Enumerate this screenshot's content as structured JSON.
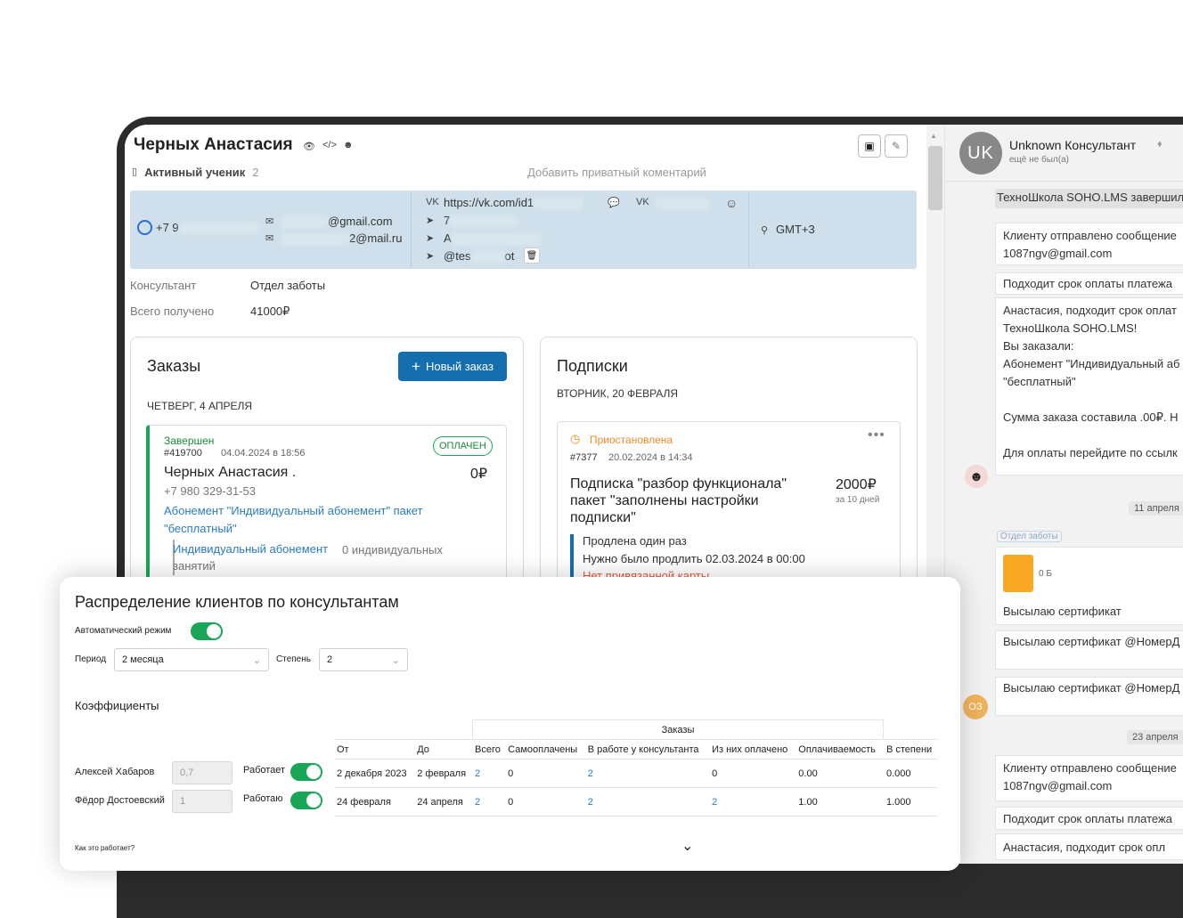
{
  "profile": {
    "name": "Черных Анастасия",
    "status": "Активный ученик",
    "status_count": "2",
    "private_comment": "Добавить приватный коментарий",
    "phone": "+7 9",
    "email1": "@gmail.com",
    "email2": "2@mail.ru",
    "vk": "https://vk.com/id1",
    "tg1": "7",
    "tg2": "A",
    "tg3": "@tes",
    "tg3_suffix": "ot",
    "tz": "GMT+3",
    "consultant_label": "Консультант",
    "consultant_value": "Отдел заботы",
    "total_label": "Всего получено",
    "total_value": "41000₽"
  },
  "orders": {
    "title": "Заказы",
    "new_button": "Новый заказ",
    "date": "ЧЕТВЕРГ, 4 АПРЕЛЯ",
    "status": "Завершен",
    "number": "#419700",
    "datetime": "04.04.2024 в 18:56",
    "badge": "ОПЛАЧЕН",
    "client": "Черных Анастасия .",
    "amount": "0₽",
    "phone": "+7 980 329-31-53",
    "product_link": "Абонемент \"Индивидуальный абонемент\" пакет \"бесплатный\"",
    "sub_item": "Индивидуальный абонемент",
    "sub_item_note": "0 индивидуальных занятий"
  },
  "subscriptions": {
    "title": "Подписки",
    "date": "ВТОРНИК, 20 ФЕВРАЛЯ",
    "status": "Приостановлена",
    "number": "#7377",
    "datetime": "20.02.2024 в 14:34",
    "name": "Подписка \"разбор функционала\" пакет \"заполнены настройки подписки\"",
    "price": "2000₽",
    "period": "за 10 дней",
    "renewed": "Продлена один раз",
    "renew_due": "Нужно было продлить 02.03.2024 в 00:00",
    "no_card": "Нет привязанной карты"
  },
  "chat": {
    "consultant_initials": "UK",
    "consultant_name": "Unknown Консультант",
    "consultant_seen": "ещё не был(а)",
    "system_banner": "ТехноШкола SOHO.LMS завершил",
    "msg1_line1": "Клиенту отправлено сообщение",
    "msg1_line2": "1087ngv@gmail.com",
    "msg2": "Подходит срок оплаты платежа",
    "msg3_lines": [
      "Анастасия, подходит срок оплат",
      "ТехноШкола SOHO.LMS!",
      "Вы заказали:",
      "Абонемент \"Индивидуальный аб",
      "\"бесплатный\"",
      "",
      "Сумма заказа составила .00₽. Н",
      "",
      "Для оплаты перейдите по ссылк"
    ],
    "date1": "11 апреля",
    "team_tag": "Отдел заботы",
    "file_size": "0 Б",
    "file_caption": "Высылаю сертификат",
    "msg4": "Высылаю сертификат @НомерД",
    "msg5": "Высылаю сертификат @НомерД",
    "avatar2_initials": "ОЗ",
    "date2": "23 апреля",
    "msg6_line1": "Клиенту отправлено сообщение",
    "msg6_line2": "1087ngv@gmail.com",
    "msg7": "Подходит срок оплаты платежа",
    "msg8": "Анастасия, подходит срок опл"
  },
  "distribution": {
    "title": "Распределение клиентов по консультантам",
    "auto_label": "Автоматический режим",
    "auto_on": true,
    "period_label": "Период",
    "period_value": "2 месяца",
    "degree_label": "Степень",
    "degree_value": "2",
    "coef_title": "Коэффициенты",
    "orders_header": "Заказы",
    "columns": [
      "От",
      "До",
      "Всего",
      "Самооплачены",
      "В работе у консультанта",
      "Из них оплачено",
      "Оплачиваемость",
      "В степени"
    ],
    "rows": [
      {
        "name": "Алексей Хабаров",
        "coef": "0,7",
        "state": "Работает",
        "from": "2 декабря 2023",
        "to": "2 февраля",
        "total": "2",
        "self": "0",
        "in_work": "2",
        "paid": "0",
        "rate": "0.00",
        "pow": "0.000"
      },
      {
        "name": "Фёдор Достоевский",
        "coef": "1",
        "state": "Работаю",
        "from": "24 февраля",
        "to": "24 апреля",
        "total": "2",
        "self": "0",
        "in_work": "2",
        "paid": "2",
        "rate": "1.00",
        "pow": "1.000"
      }
    ],
    "how_it_works": "Как это работает?"
  },
  "colors": {
    "accent": "#156fae",
    "success": "#1aa657",
    "warning": "#f08a24",
    "info_bg": "#cfe0ec"
  }
}
